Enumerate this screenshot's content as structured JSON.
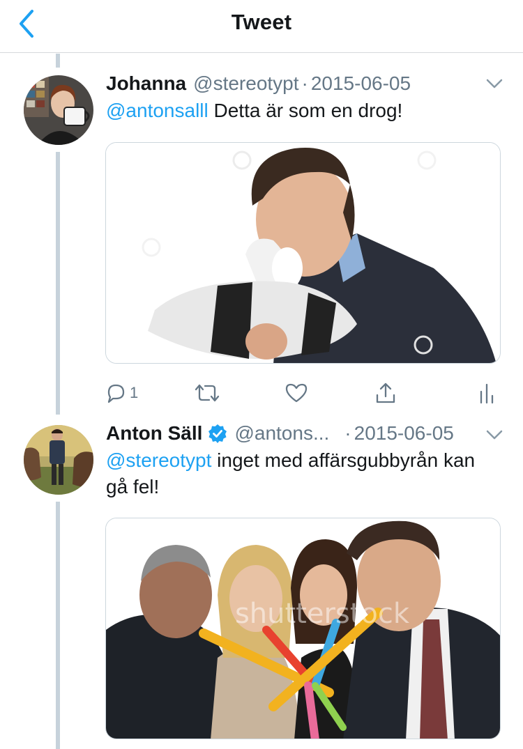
{
  "header": {
    "title": "Tweet",
    "back_icon": "chevron-left-icon",
    "accent_color": "#1da1f2"
  },
  "tweets": [
    {
      "name": "Johanna",
      "handle": "@stereotypt",
      "separator": "·",
      "date": "2015-06-05",
      "verified": false,
      "text_mention": "@antonsalll",
      "text_rest": " Detta är som en drog!",
      "media_description": "photo",
      "actions": {
        "reply_count": "1",
        "reply_icon": "reply-icon",
        "retweet_icon": "retweet-icon",
        "like_icon": "heart-icon",
        "share_icon": "share-icon",
        "analytics_icon": "analytics-icon"
      }
    },
    {
      "name": "Anton Säll",
      "handle": "@antons...",
      "separator": "·",
      "date": "2015-06-05",
      "verified": true,
      "text_mention": "@stereotypt",
      "text_rest": " inget med affärsgubbyrån kan gå fel!",
      "media_description": "photo",
      "media_watermark": "shutterstock"
    }
  ],
  "colors": {
    "text": "#14171a",
    "secondary": "#657786",
    "thread_line": "#c7d2db",
    "divider": "#d6d9db"
  }
}
